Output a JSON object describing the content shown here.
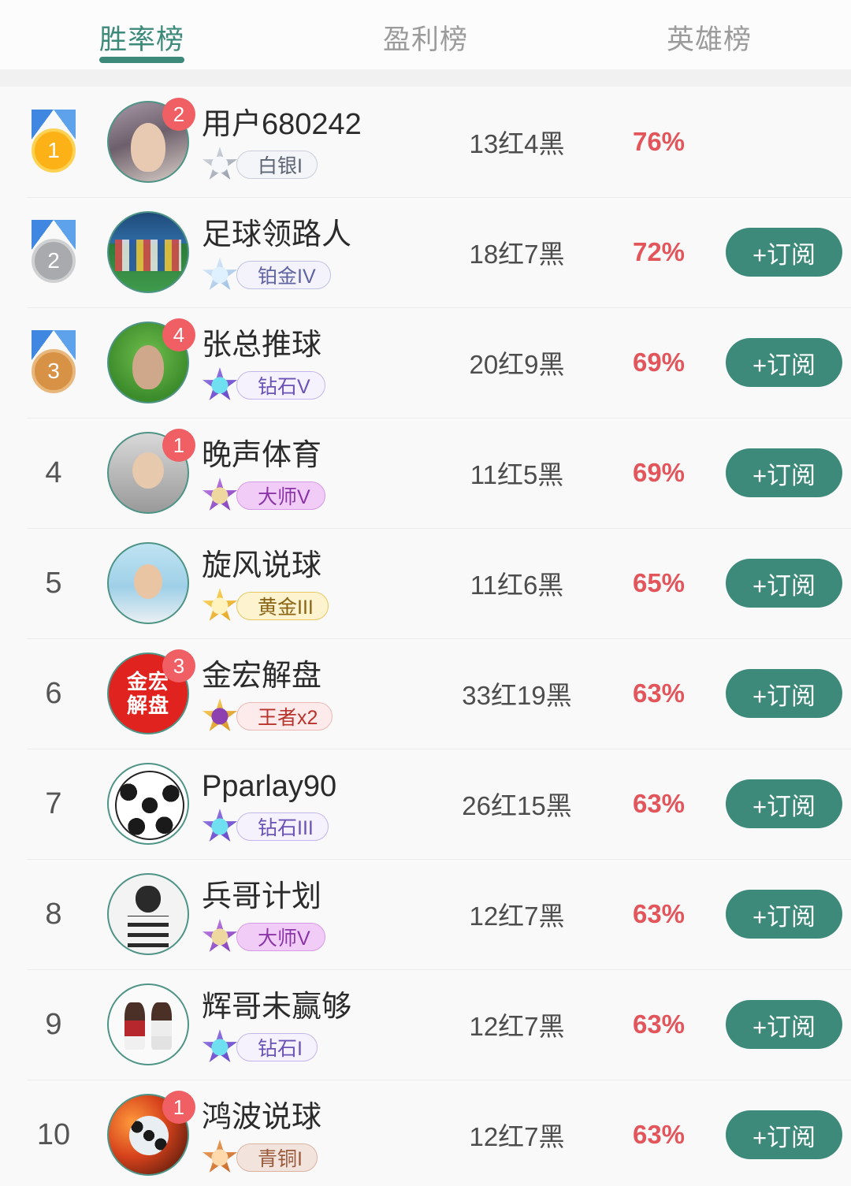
{
  "tabs": [
    {
      "label": "胜率榜",
      "active": true
    },
    {
      "label": "盈利榜",
      "active": false
    },
    {
      "label": "英雄榜",
      "active": false
    }
  ],
  "theme": {
    "accent": "#3d8a7a",
    "percent_color": "#e2565b",
    "badge_color": "#ef5f64",
    "page_bg": "#f9f9f9"
  },
  "subscribe_label": "+订阅",
  "rows": [
    {
      "rank": "1",
      "medal": "gold",
      "name": "用户680242",
      "notif": "2",
      "tier": {
        "label": "白银I",
        "theme": "t-silver"
      },
      "record": "13红4黑",
      "percent": "76%",
      "subscribe": false,
      "avatar": "av-person1"
    },
    {
      "rank": "2",
      "medal": "silver",
      "name": "足球领路人",
      "notif": "",
      "tier": {
        "label": "铂金IV",
        "theme": "t-platinum"
      },
      "record": "18红7黑",
      "percent": "72%",
      "subscribe": true,
      "avatar": "av-team"
    },
    {
      "rank": "3",
      "medal": "bronze",
      "name": "张总推球",
      "notif": "4",
      "tier": {
        "label": "钻石V",
        "theme": "t-diamond"
      },
      "record": "20红9黑",
      "percent": "69%",
      "subscribe": true,
      "avatar": "av-green"
    },
    {
      "rank": "4",
      "medal": "",
      "name": "晚声体育",
      "notif": "1",
      "tier": {
        "label": "大师V",
        "theme": "t-master"
      },
      "record": "11红5黑",
      "percent": "69%",
      "subscribe": true,
      "avatar": "av-suit"
    },
    {
      "rank": "5",
      "medal": "",
      "name": "旋风说球",
      "notif": "",
      "tier": {
        "label": "黄金III",
        "theme": "t-gold"
      },
      "record": "11红6黑",
      "percent": "65%",
      "subscribe": true,
      "avatar": "av-sky"
    },
    {
      "rank": "6",
      "medal": "",
      "name": "金宏解盘",
      "notif": "3",
      "tier": {
        "label": "王者x2",
        "theme": "t-king"
      },
      "record": "33红19黑",
      "percent": "63%",
      "subscribe": true,
      "avatar": "av-redlogo",
      "avatar_text": "金宏\n解盘"
    },
    {
      "rank": "7",
      "medal": "",
      "name": "Pparlay90",
      "notif": "",
      "tier": {
        "label": "钻石III",
        "theme": "t-diamond"
      },
      "record": "26红15黑",
      "percent": "63%",
      "subscribe": true,
      "avatar": "av-ball"
    },
    {
      "rank": "8",
      "medal": "",
      "name": "兵哥计划",
      "notif": "",
      "tier": {
        "label": "大师V",
        "theme": "t-master"
      },
      "record": "12红7黑",
      "percent": "63%",
      "subscribe": true,
      "avatar": "av-dog"
    },
    {
      "rank": "9",
      "medal": "",
      "name": "辉哥未赢够",
      "notif": "",
      "tier": {
        "label": "钻石I",
        "theme": "t-diamond"
      },
      "record": "12红7黑",
      "percent": "63%",
      "subscribe": true,
      "avatar": "av-players"
    },
    {
      "rank": "10",
      "medal": "",
      "name": "鸿波说球",
      "notif": "1",
      "tier": {
        "label": "青铜I",
        "theme": "t-bronze"
      },
      "record": "12红7黑",
      "percent": "63%",
      "subscribe": true,
      "avatar": "av-fireball"
    }
  ]
}
